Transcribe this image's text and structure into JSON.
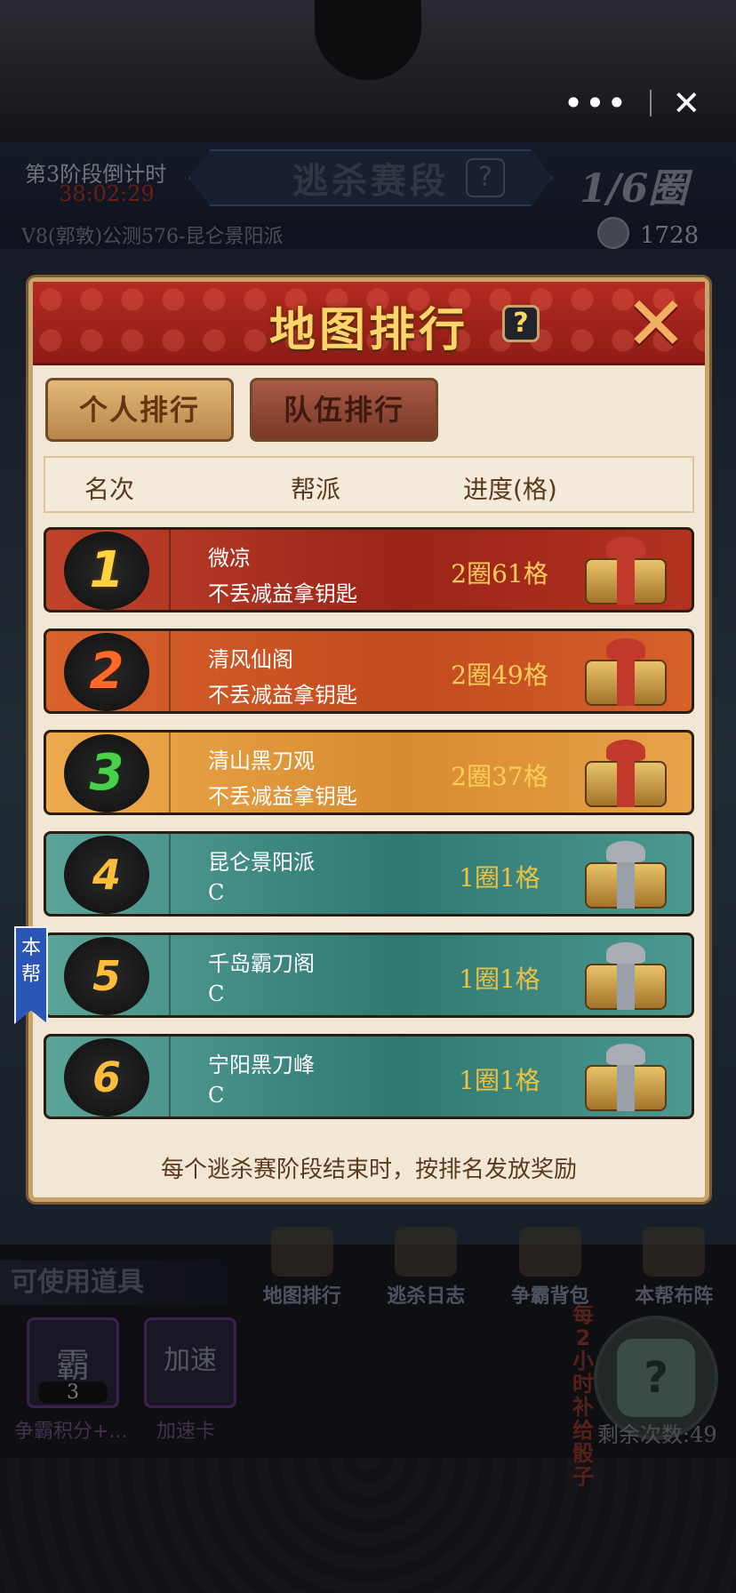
{
  "top_bar": {
    "menu_label": "•••",
    "close_label": "✕"
  },
  "stage": {
    "countdown_label": "第3阶段倒计时",
    "countdown_time": "38:02:29",
    "banner_title": "逃杀赛段",
    "help_label": "?",
    "round": "1/6圈"
  },
  "server_line": "V8(郭敦)公测576-昆仑景阳派",
  "coins": {
    "icon": "coin-icon",
    "value": "1728"
  },
  "modal": {
    "title": "地图排行",
    "help_label": "?",
    "close_label": "✕",
    "tabs": [
      {
        "label": "个人排行",
        "active": true
      },
      {
        "label": "队伍排行",
        "active": false
      }
    ],
    "columns": [
      "名次",
      "帮派",
      "进度(格)"
    ],
    "rows": [
      {
        "rank": "1",
        "name": "微凉",
        "subtitle": "不丢减益拿钥匙",
        "progress": "2圈61格",
        "chest": "gold-chest"
      },
      {
        "rank": "2",
        "name": "清风仙阁",
        "subtitle": "不丢减益拿钥匙",
        "progress": "2圈49格",
        "chest": "gold-chest"
      },
      {
        "rank": "3",
        "name": "清山黑刀观",
        "subtitle": "不丢减益拿钥匙",
        "progress": "2圈37格",
        "chest": "gold-chest"
      },
      {
        "rank": "4",
        "name": "昆仑景阳派",
        "subtitle": "C",
        "progress": "1圈1格",
        "chest": "silver-chest"
      },
      {
        "rank": "5",
        "name": "千岛霸刀阁",
        "subtitle": "C",
        "progress": "1圈1格",
        "chest": "silver-chest"
      },
      {
        "rank": "6",
        "name": "宁阳黑刀峰",
        "subtitle": "C",
        "progress": "1圈1格",
        "chest": "silver-chest"
      }
    ],
    "own_badge": "本帮",
    "footer_note": "每个逃杀赛阶段结束时，按排名发放奖励"
  },
  "bottom_menu": [
    {
      "label": "地图排行"
    },
    {
      "label": "逃杀日志"
    },
    {
      "label": "争霸背包"
    },
    {
      "label": "本帮布阵"
    }
  ],
  "tools": {
    "title": "可使用道具",
    "items": [
      {
        "glyph": "霸",
        "count": "3",
        "name": "争霸积分+..."
      },
      {
        "glyph": "加速",
        "name": "加速卡"
      }
    ]
  },
  "supply": {
    "side_label": "每2小时补给骰子",
    "dice_glyph": "?",
    "remaining": "剩余次数:49"
  },
  "colors": {
    "modal_header": "#b42a20",
    "gold_text": "#ffd46a",
    "teal_row": "#2f7873",
    "badge_blue": "#2b56b8"
  }
}
